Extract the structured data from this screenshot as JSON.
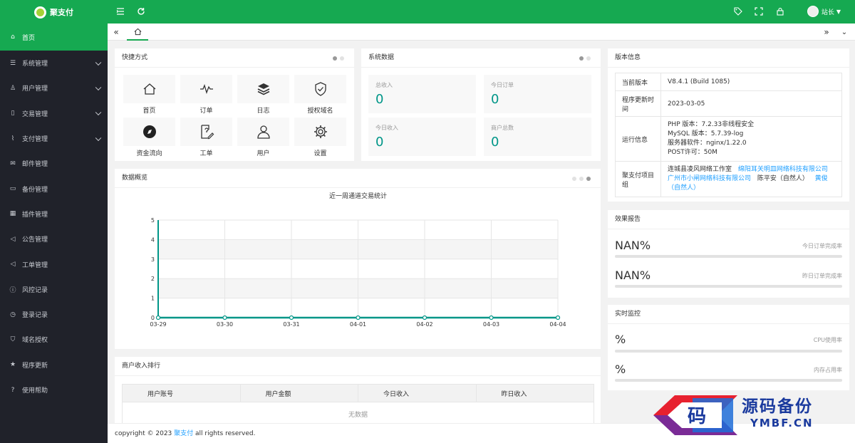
{
  "app": {
    "name": "聚支付",
    "user": "站长"
  },
  "sidebar": {
    "items": [
      {
        "label": "首页",
        "icon": "home-icon",
        "glyph": "⌂",
        "expandable": false,
        "active": true
      },
      {
        "label": "系统管理",
        "icon": "sliders-icon",
        "glyph": "☰",
        "expandable": true
      },
      {
        "label": "用户管理",
        "icon": "user-icon",
        "glyph": "♙",
        "expandable": true
      },
      {
        "label": "交易管理",
        "icon": "file-icon",
        "glyph": "▯",
        "expandable": true
      },
      {
        "label": "支付管理",
        "icon": "pulse-icon",
        "glyph": "⌇",
        "expandable": true
      },
      {
        "label": "邮件管理",
        "icon": "mail-icon",
        "glyph": "✉",
        "expandable": false
      },
      {
        "label": "备份管理",
        "icon": "note-icon",
        "glyph": "▭",
        "expandable": false
      },
      {
        "label": "插件管理",
        "icon": "app-icon",
        "glyph": "▦",
        "expandable": false
      },
      {
        "label": "公告管理",
        "icon": "speaker-icon",
        "glyph": "◁",
        "expandable": false
      },
      {
        "label": "工单管理",
        "icon": "speaker-icon",
        "glyph": "◁",
        "expandable": false
      },
      {
        "label": "风控记录",
        "icon": "info-icon",
        "glyph": "ⓘ",
        "expandable": false
      },
      {
        "label": "登录记录",
        "icon": "clock-icon",
        "glyph": "◷",
        "expandable": false
      },
      {
        "label": "域名授权",
        "icon": "shield-icon",
        "glyph": "⛉",
        "expandable": false
      },
      {
        "label": "程序更新",
        "icon": "star-icon",
        "glyph": "★",
        "expandable": false
      },
      {
        "label": "使用帮助",
        "icon": "help-icon",
        "glyph": "?",
        "expandable": false
      }
    ]
  },
  "shortcuts": {
    "title": "快捷方式",
    "items": [
      {
        "label": "首页",
        "icon": "home-icon"
      },
      {
        "label": "订单",
        "icon": "pulse-icon"
      },
      {
        "label": "日志",
        "icon": "layers-icon"
      },
      {
        "label": "授权域名",
        "icon": "shield-check-icon"
      },
      {
        "label": "资金流向",
        "icon": "compass-icon"
      },
      {
        "label": "工单",
        "icon": "edit-icon"
      },
      {
        "label": "用户",
        "icon": "user-icon"
      },
      {
        "label": "设置",
        "icon": "gear-icon"
      }
    ]
  },
  "system_data": {
    "title": "系统数据",
    "stats": [
      {
        "label": "总收入",
        "value": "0"
      },
      {
        "label": "今日订单",
        "value": "0"
      },
      {
        "label": "今日收入",
        "value": "0"
      },
      {
        "label": "商户总数",
        "value": "0"
      }
    ]
  },
  "overview": {
    "title": "数据概览",
    "chart_data": {
      "type": "line",
      "title": "近一周通道交易统计",
      "categories": [
        "03-29",
        "03-30",
        "03-31",
        "04-01",
        "04-02",
        "04-03",
        "04-04"
      ],
      "series": [
        {
          "values": [
            0,
            0,
            0,
            0,
            0,
            0,
            0
          ],
          "color": "#009688"
        }
      ],
      "ylim": [
        0,
        5
      ],
      "yticks": [
        "0",
        "1",
        "2",
        "3",
        "4",
        "5"
      ],
      "grid": true
    }
  },
  "version": {
    "title": "版本信息",
    "rows": [
      {
        "key": "当前版本",
        "value": "V8.4.1 (Build 1085)"
      },
      {
        "key": "程序更新时间",
        "value": "2023-03-05"
      },
      {
        "key": "运行信息",
        "lines": [
          "PHP 版本：7.2.33非线程安全",
          "MySQL 版本：5.7.39-log",
          "服务器软件：nginx/1.22.0",
          "POST许可：50M"
        ]
      },
      {
        "key": "聚支付项目组",
        "team": [
          {
            "text": "连城县凌风网络工作室",
            "link": false
          },
          {
            "text": "绵阳耳关明皿网络科技有限公司",
            "link": true
          },
          {
            "text": "广州市小闸网络科技有限公司",
            "link": true
          },
          {
            "text": "陈平安（自然人）",
            "link": false
          },
          {
            "text": "黄俊（自然人）",
            "link": true
          }
        ]
      }
    ]
  },
  "report": {
    "title": "效果报告",
    "items": [
      {
        "value": "NAN%",
        "caption": "今日订单完成率",
        "progress": 0
      },
      {
        "value": "NAN%",
        "caption": "昨日订单完成率",
        "progress": 0
      }
    ]
  },
  "monitor": {
    "title": "实时监控",
    "items": [
      {
        "value": "%",
        "caption": "CPU使用率",
        "progress": 0
      },
      {
        "value": "%",
        "caption": "内存占用率",
        "progress": 0
      }
    ]
  },
  "ranking": {
    "title": "商户收入排行",
    "columns": [
      "用户账号",
      "用户金额",
      "今日收入",
      "昨日收入"
    ],
    "empty": "无数据"
  },
  "footer": {
    "prefix": "copyright © 2023 ",
    "brand": "聚支付",
    "suffix": " all rights reserved."
  },
  "watermark": {
    "glyph": "码",
    "title": "源码备份",
    "url": "YMBF.CN"
  }
}
